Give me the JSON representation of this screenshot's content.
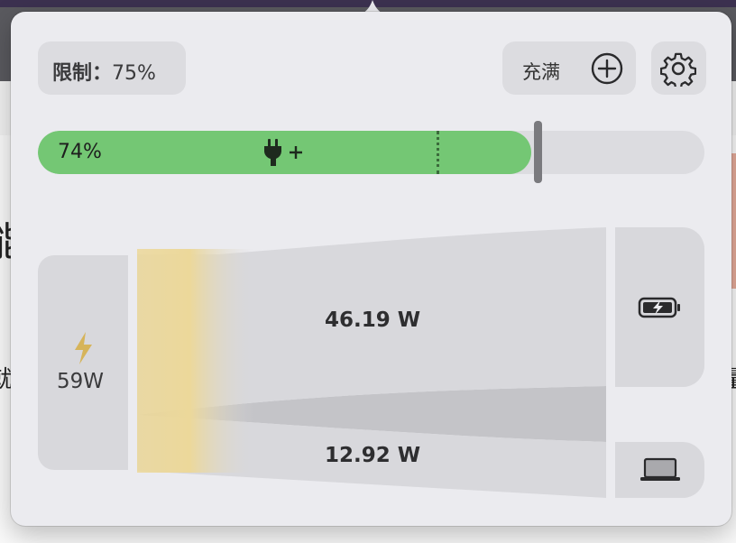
{
  "limit": {
    "label": "限制",
    "separator": "：",
    "value": "75%"
  },
  "charge_button": {
    "label": "充满",
    "icon": "plus-circle-icon"
  },
  "settings_button": {
    "icon": "gear-icon"
  },
  "battery_bar": {
    "percent_text": "74%",
    "percent": 74,
    "limit_percent": 75,
    "charging_icon": "plug-plus-icon",
    "fill_color": "#74c774"
  },
  "power_flow": {
    "source": {
      "icon": "bolt-icon",
      "watts": "59W"
    },
    "to_battery": {
      "watts": "46.19 W",
      "icon": "battery-charging-icon"
    },
    "to_system": {
      "watts": "12.92 W",
      "icon": "laptop-icon"
    }
  },
  "background": {
    "glyph_1": "能",
    "glyph_2": "就",
    "glyph_3": "量"
  }
}
